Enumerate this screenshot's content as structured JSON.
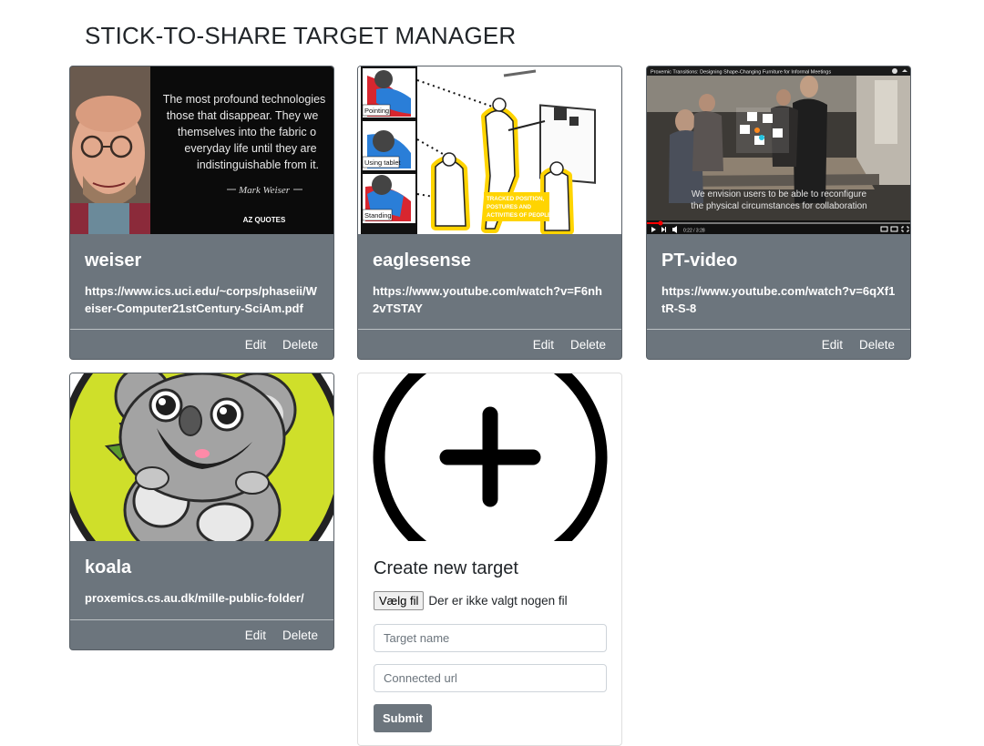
{
  "page": {
    "title": "STICK-TO-SHARE TARGET MANAGER"
  },
  "targets": [
    {
      "name": "weiser",
      "url": "https://www.ics.uci.edu/~corps/phaseii/Weiser-Computer21stCentury-SciAm.pdf",
      "edit_label": "Edit",
      "delete_label": "Delete",
      "thumb": {
        "quote": [
          "The most profound technologies",
          "those that disappear. They we",
          "themselves into the fabric o",
          "everyday life until they are",
          "indistinguishable from it."
        ],
        "author": "Mark Weiser",
        "brand": "AZ QUOTES"
      }
    },
    {
      "name": "eaglesense",
      "url": "https://www.youtube.com/watch?v=F6nh2vTSTAY",
      "edit_label": "Edit",
      "delete_label": "Delete",
      "thumb": {
        "labels": [
          "Pointing",
          "Using tablet",
          "Standing"
        ],
        "caption": [
          "TRACKED POSITION,",
          "POSTURES AND",
          "ACTIVITIES OF PEOPLE"
        ]
      }
    },
    {
      "name": "PT-video",
      "url": "https://www.youtube.com/watch?v=6qXf1tR-S-8",
      "edit_label": "Edit",
      "delete_label": "Delete",
      "thumb": {
        "video_title": "Proxemic Transitions: Designing Shape-Changing Furniture for Informal Meetings",
        "subtitle": [
          "We envision users to be able to reconfigure",
          "the physical circumstances for collaboration"
        ],
        "time": "0:22 / 3:28"
      }
    },
    {
      "name": "koala",
      "url": "proxemics.cs.au.dk/mille-public-folder/",
      "edit_label": "Edit",
      "delete_label": "Delete"
    }
  ],
  "create": {
    "heading": "Create new target",
    "file_button": "Vælg fil",
    "file_status": "Der er ikke valgt nogen fil",
    "name_placeholder": "Target name",
    "url_placeholder": "Connected url",
    "submit_label": "Submit"
  },
  "colors": {
    "card_bg": "#6c757d",
    "koala_bg": "#cfdf2a",
    "eaglesense_yellow": "#ffd400"
  }
}
